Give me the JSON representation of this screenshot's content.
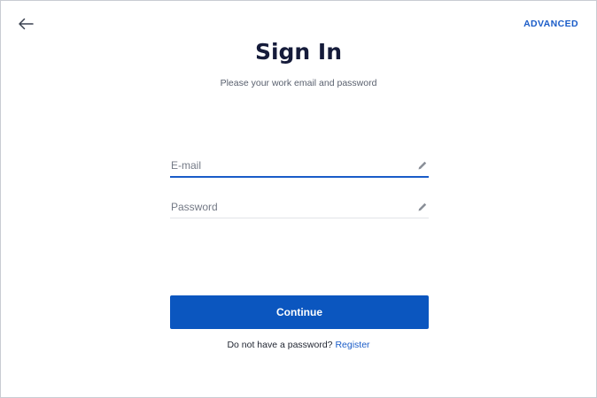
{
  "header": {
    "back_icon": "arrow-left-icon",
    "advanced_label": "ADVANCED"
  },
  "main": {
    "title": "Sign In",
    "subtitle": "Please your work email and password"
  },
  "form": {
    "email": {
      "placeholder": "E-mail",
      "value": "",
      "icon": "pencil-icon",
      "focused": true
    },
    "password": {
      "placeholder": "Password",
      "value": "",
      "icon": "pencil-icon"
    },
    "continue_label": "Continue"
  },
  "footer": {
    "prompt": "Do not have a password?",
    "register_label": "Register"
  },
  "colors": {
    "accent": "#0b56bf",
    "link": "#1a5cc8",
    "title": "#151b3a",
    "subtitle": "#59606e"
  }
}
